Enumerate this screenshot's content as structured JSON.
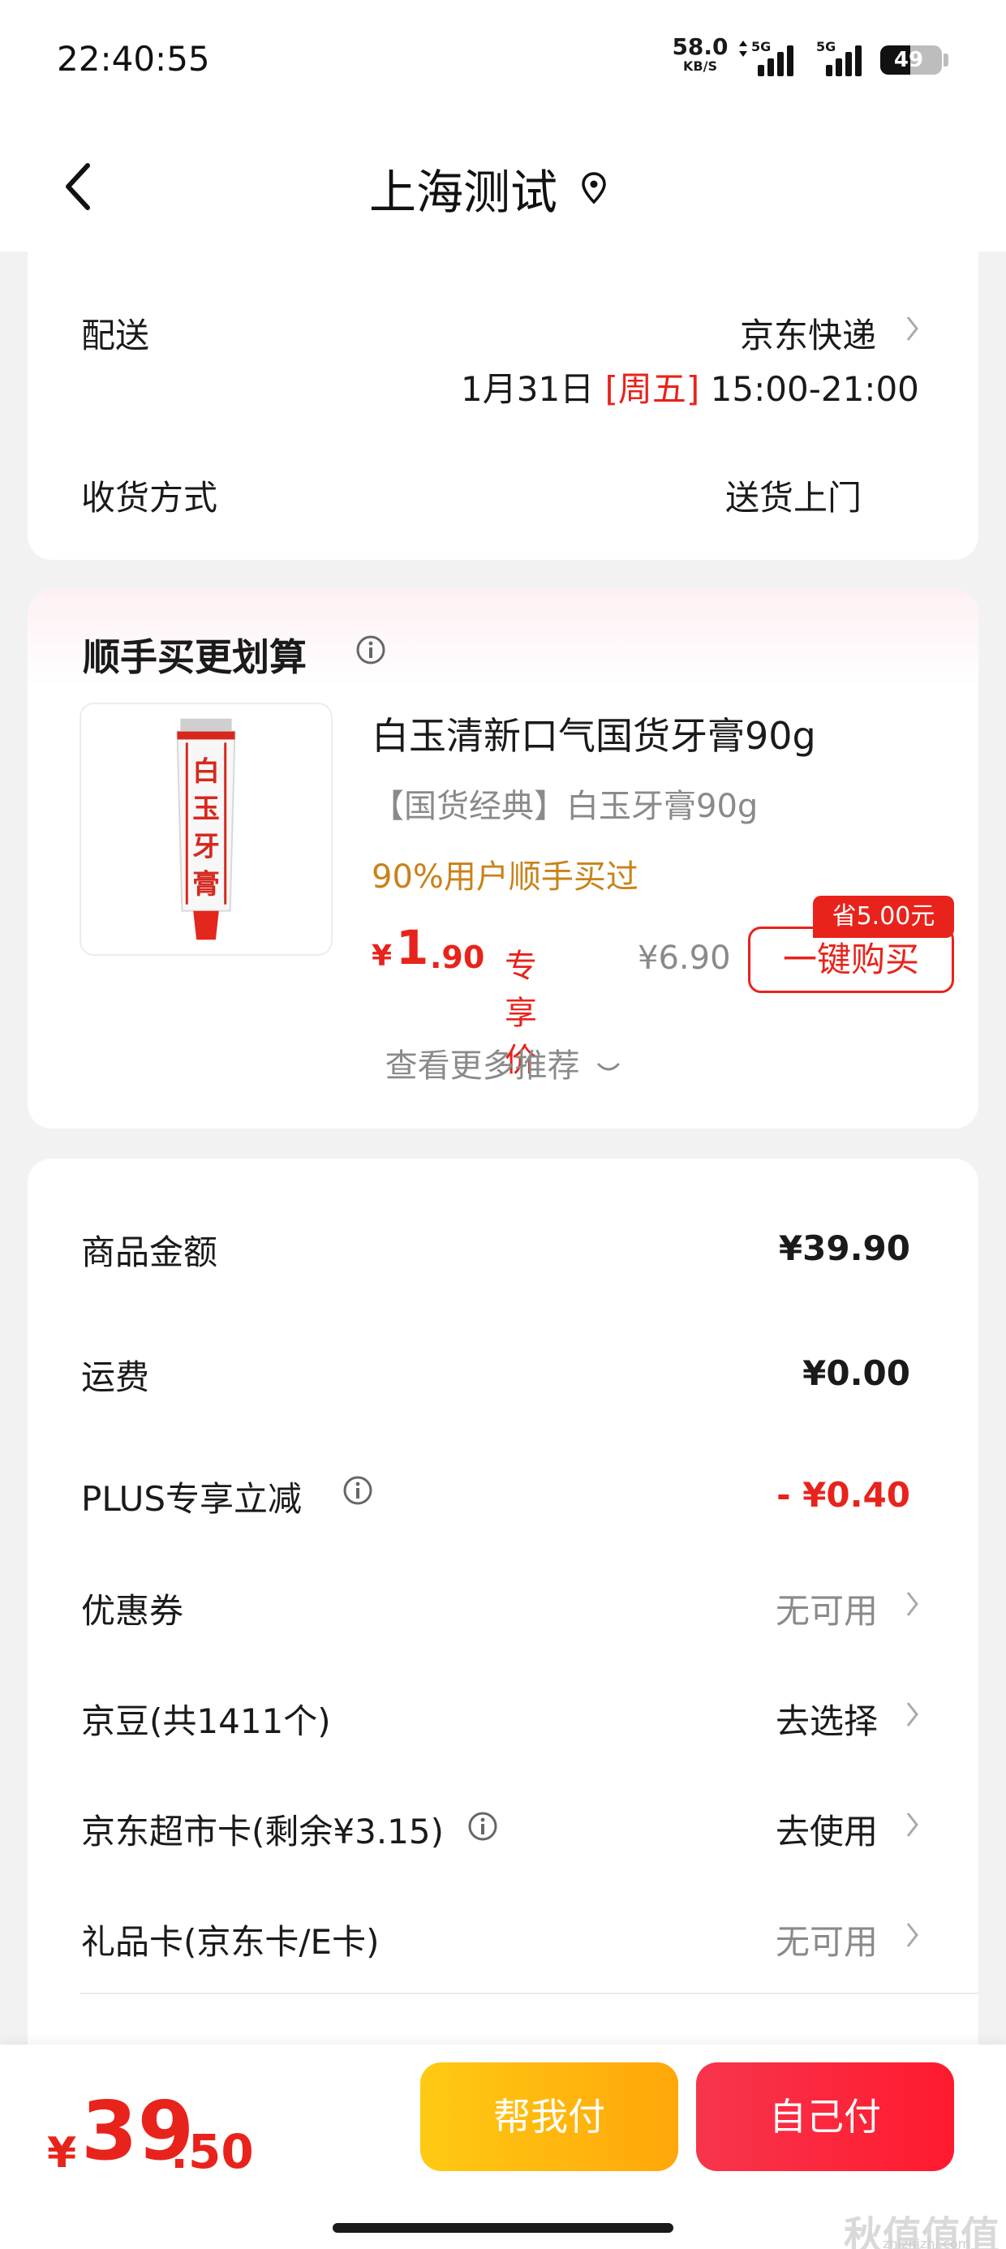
{
  "status_bar": {
    "time": "22:40:55",
    "net_speed": "58.0",
    "net_unit": "KB/S",
    "sim1": "5G",
    "sim2": "5G",
    "battery": "49"
  },
  "header": {
    "title": "上海测试",
    "icons": [
      "back-arrow-icon",
      "location-pin-icon"
    ]
  },
  "delivery": {
    "label": "配送",
    "carrier": "京东快递",
    "date": "1月31日",
    "weekday": "[周五]",
    "time_window": "15:00-21:00",
    "method_label": "收货方式",
    "method_value": "送货上门"
  },
  "upsell": {
    "title": "顺手买更划算",
    "product_name": "白玉清新口气国货牙膏90g",
    "product_subtitle": "【国货经典】白玉牙膏90g",
    "social_proof": "90%用户顺手买过",
    "price_symbol": "¥",
    "price_int": "1",
    "price_dec": ".90",
    "price_tag": "专享价",
    "original_price": "¥6.90",
    "save_badge": "省5.00元",
    "buy_button": "一键购买",
    "more": "查看更多推荐",
    "tube_text": "白玉牙膏"
  },
  "summary": {
    "rows": [
      {
        "label": "商品金额",
        "value": "¥39.90"
      },
      {
        "label": "运费",
        "value": "¥0.00"
      },
      {
        "label": "PLUS专享立减",
        "value": "- ¥0.40"
      },
      {
        "label": "优惠券",
        "value": "无可用"
      },
      {
        "label": "京豆(共1411个)",
        "value": "去选择"
      },
      {
        "label": "京东超市卡(剩余¥3.15)",
        "value": "去使用"
      },
      {
        "label": "礼品卡(京东卡/E卡)",
        "value": "无可用"
      }
    ]
  },
  "bottom_bar": {
    "total_symbol": "¥",
    "total_int": "39",
    "total_dec": ".50",
    "help_pay": "帮我付",
    "self_pay": "自己付",
    "watermark": "秋值值值",
    "watermark_url": "zhizhizhi.com"
  },
  "colors": {
    "accent_red": "#e8231b",
    "gold": "#c9821a",
    "help_btn": "#ffb90e",
    "self_btn": "#fa283e"
  }
}
